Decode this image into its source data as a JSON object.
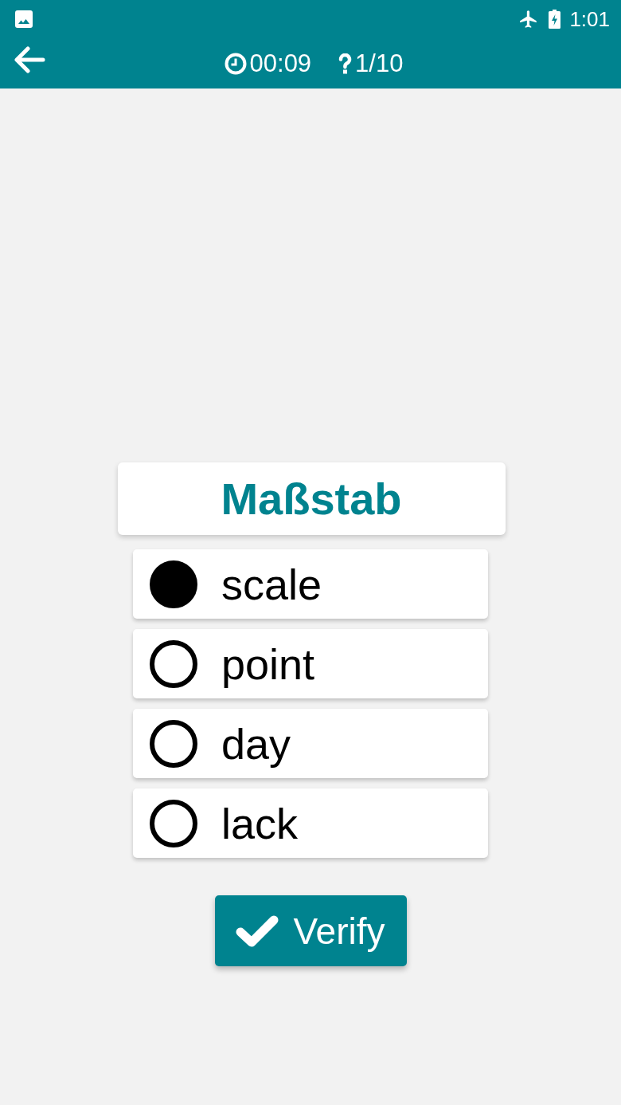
{
  "status_bar": {
    "time": "1:01"
  },
  "header": {
    "timer": "00:09",
    "progress": "1/10"
  },
  "question": {
    "word": "Maßstab"
  },
  "options": [
    {
      "label": "scale",
      "selected": true
    },
    {
      "label": "point",
      "selected": false
    },
    {
      "label": "day",
      "selected": false
    },
    {
      "label": "lack",
      "selected": false
    }
  ],
  "verify_button": {
    "label": "Verify"
  }
}
